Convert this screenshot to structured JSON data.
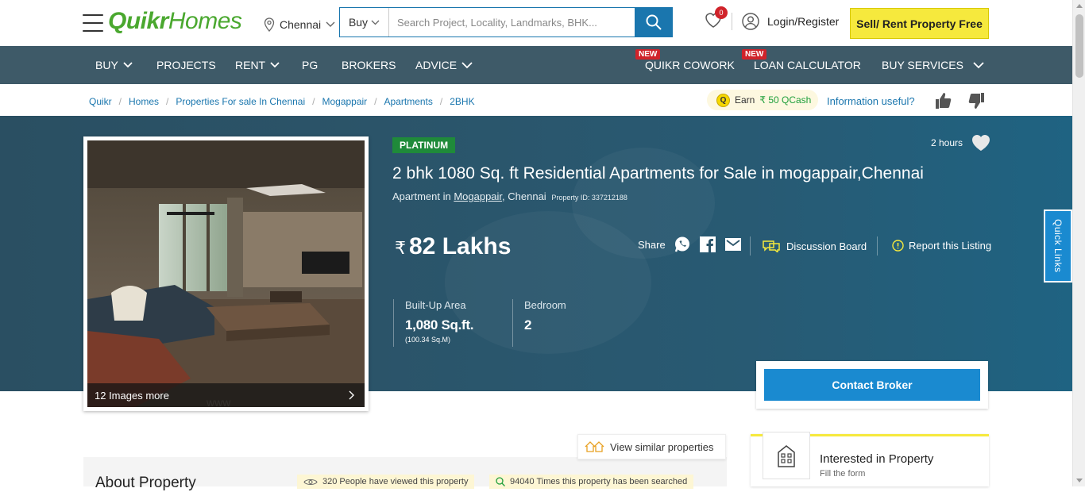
{
  "header": {
    "logo_part1": "Quikr",
    "logo_part2": "Homes",
    "city": "Chennai",
    "search_type": "Buy",
    "search_placeholder": "Search Project, Locality, Landmarks, BHK...",
    "wishlist_count": "0",
    "login_label": "Login/Register",
    "sell_label": "Sell/ Rent Property Free"
  },
  "nav": {
    "items": [
      {
        "label": "BUY"
      },
      {
        "label": "PROJECTS"
      },
      {
        "label": "RENT"
      },
      {
        "label": "PG"
      },
      {
        "label": "BROKERS"
      },
      {
        "label": "ADVICE"
      },
      {
        "label": "QUIKR COWORK",
        "tag": "NEW"
      },
      {
        "label": "LOAN CALCULATOR",
        "tag": "NEW"
      },
      {
        "label": "BUY SERVICES"
      }
    ]
  },
  "breadcrumb": [
    "Quikr",
    "Homes",
    "Properties For sale In Chennai",
    "Mogappair",
    "Apartments",
    "2BHK"
  ],
  "qcash": {
    "prefix": "Earn",
    "amount": "₹ 50 QCash",
    "coin": "Q"
  },
  "feedback": {
    "question": "Information useful?"
  },
  "listing": {
    "tier": "PLATINUM",
    "posted": "2 hours",
    "title": "2 bhk 1080 Sq. ft Residential Apartments for Sale in mogappair,Chennai",
    "type_prefix": "Apartment in",
    "locality": "Mogappair",
    "city_suffix": ", Chennai",
    "property_id": "Property ID: 337212188",
    "currency": "₹",
    "price": "82 Lakhs",
    "images_more": "12 Images more",
    "share_label": "Share",
    "discussion_label": "Discussion Board",
    "report_label": "Report this Listing",
    "stats": [
      {
        "label": "Built-Up Area",
        "value": "1,080 Sq.ft.",
        "sub": "(100.34 Sq.M)"
      },
      {
        "label": "Bedroom",
        "value": "2"
      }
    ],
    "contact_label": "Contact Broker"
  },
  "below": {
    "similar_label": "View similar properties",
    "about_title": "About Property",
    "viewed_text": "320 People have viewed this property",
    "searched_text": "94040 Times this property has been searched",
    "interest_title": "Interested in Property",
    "interest_sub": "Fill the form"
  },
  "side": {
    "quick_links": "Quick Links"
  },
  "colors": {
    "brand_green": "#4aa82f",
    "nav_bg": "#3e5a68",
    "primary_blue": "#1a76ae",
    "sell_yellow": "#f6e93d",
    "badge_red": "#d0232a"
  }
}
